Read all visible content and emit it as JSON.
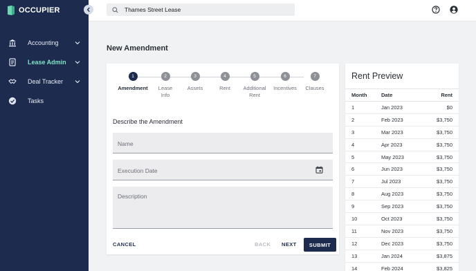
{
  "app": {
    "brand": "OCCUPIER"
  },
  "sidebar": {
    "items": [
      {
        "label": "Accounting",
        "icon": "bank-icon",
        "active": false,
        "expandable": true
      },
      {
        "label": "Lease Admin",
        "icon": "document-icon",
        "active": true,
        "expandable": true
      },
      {
        "label": "Deal Tracker",
        "icon": "handshake-icon",
        "active": false,
        "expandable": true
      },
      {
        "label": "Tasks",
        "icon": "check-circle-icon",
        "active": false,
        "expandable": false
      }
    ]
  },
  "search": {
    "value": "Thames Street Lease",
    "icon": "search-icon"
  },
  "topbar": {
    "help_icon": "help-circle-icon",
    "account_icon": "account-circle-icon"
  },
  "page": {
    "title": "New Amendment"
  },
  "stepper": {
    "steps": [
      {
        "number": "1",
        "label": "Amendment",
        "active": true
      },
      {
        "number": "2",
        "label": "Lease Info",
        "active": false
      },
      {
        "number": "3",
        "label": "Assets",
        "active": false
      },
      {
        "number": "4",
        "label": "Rent",
        "active": false
      },
      {
        "number": "5",
        "label": "Additional Rent",
        "active": false
      },
      {
        "number": "6",
        "label": "Incentives",
        "active": false
      },
      {
        "number": "7",
        "label": "Clauses",
        "active": false
      }
    ]
  },
  "form": {
    "heading": "Describe the Amendment",
    "name_placeholder": "Name",
    "execution_date_placeholder": "Execution Date",
    "description_placeholder": "Description",
    "cancel_label": "CANCEL",
    "back_label": "BACK",
    "next_label": "NEXT",
    "submit_label": "SUBMIT"
  },
  "rent_preview": {
    "title": "Rent Preview",
    "columns": [
      "Month",
      "Date",
      "Rent"
    ],
    "rows": [
      [
        "1",
        "Jan 2023",
        "$0"
      ],
      [
        "2",
        "Feb 2023",
        "$3,750"
      ],
      [
        "3",
        "Mar 2023",
        "$3,750"
      ],
      [
        "4",
        "Apr 2023",
        "$3,750"
      ],
      [
        "5",
        "May 2023",
        "$3,750"
      ],
      [
        "6",
        "Jun 2023",
        "$3,750"
      ],
      [
        "7",
        "Jul 2023",
        "$3,750"
      ],
      [
        "8",
        "Aug 2023",
        "$3,750"
      ],
      [
        "9",
        "Sep 2023",
        "$3,750"
      ],
      [
        "10",
        "Oct 2023",
        "$3,750"
      ],
      [
        "11",
        "Nov 2023",
        "$3,750"
      ],
      [
        "12",
        "Dec 2023",
        "$3,750"
      ],
      [
        "13",
        "Jan 2024",
        "$3,875"
      ],
      [
        "14",
        "Feb 2024",
        "$3,825"
      ]
    ]
  },
  "colors": {
    "sidebar": "#1d2b4f",
    "accent": "#7fe3c4",
    "primary": "#1d2b4f"
  }
}
